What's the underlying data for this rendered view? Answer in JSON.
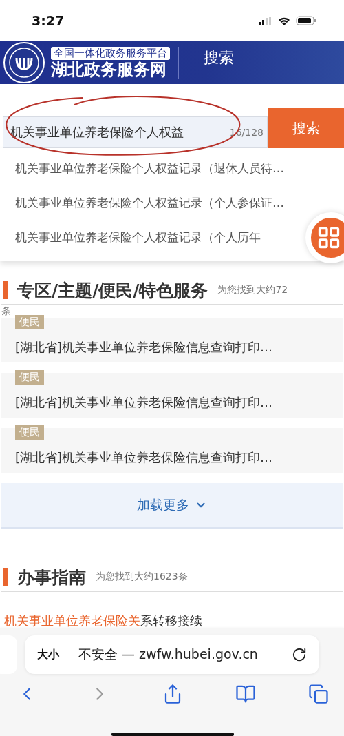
{
  "status_bar": {
    "time": "3:27"
  },
  "header": {
    "platform": "全国一体化政务服务平台",
    "site_name": "湖北政务服务网",
    "title": "搜索"
  },
  "search": {
    "value": "机关事业单位养老保险个人权益",
    "counter": "16/128",
    "button": "搜索"
  },
  "suggestions": [
    "机关事业单位养老保险个人权益记录（退休人员待…",
    "机关事业单位养老保险个人权益记录（个人参保证…",
    "机关事业单位养老保险个人权益记录（个人历年"
  ],
  "sections": [
    {
      "title": "专区/主题/便民/特色服务",
      "count": "为您找到大约72",
      "count_tail": "条",
      "cards": [
        {
          "tag": "便民",
          "title": "[湖北省]机关事业单位养老保险信息查询打印…"
        },
        {
          "tag": "便民",
          "title": "[湖北省]机关事业单位养老保险信息查询打印…"
        },
        {
          "tag": "便民",
          "title": "[湖北省]机关事业单位养老保险信息查询打印…"
        }
      ],
      "load_more": "加载更多"
    },
    {
      "title": "办事指南",
      "count": "为您找到大约1623条",
      "result": {
        "match": "机关事业单位养老保险关",
        "rest": "系转移接续"
      }
    }
  ],
  "browser": {
    "text_size": "大小",
    "address": "不安全 — zwfw.hubei.gov.cn",
    "toolbar": [
      {
        "kind": "back",
        "disabled": false
      },
      {
        "kind": "forward",
        "disabled": true
      },
      {
        "kind": "share",
        "disabled": false
      },
      {
        "kind": "bookmarks",
        "disabled": false
      },
      {
        "kind": "tabs",
        "disabled": false
      }
    ]
  }
}
